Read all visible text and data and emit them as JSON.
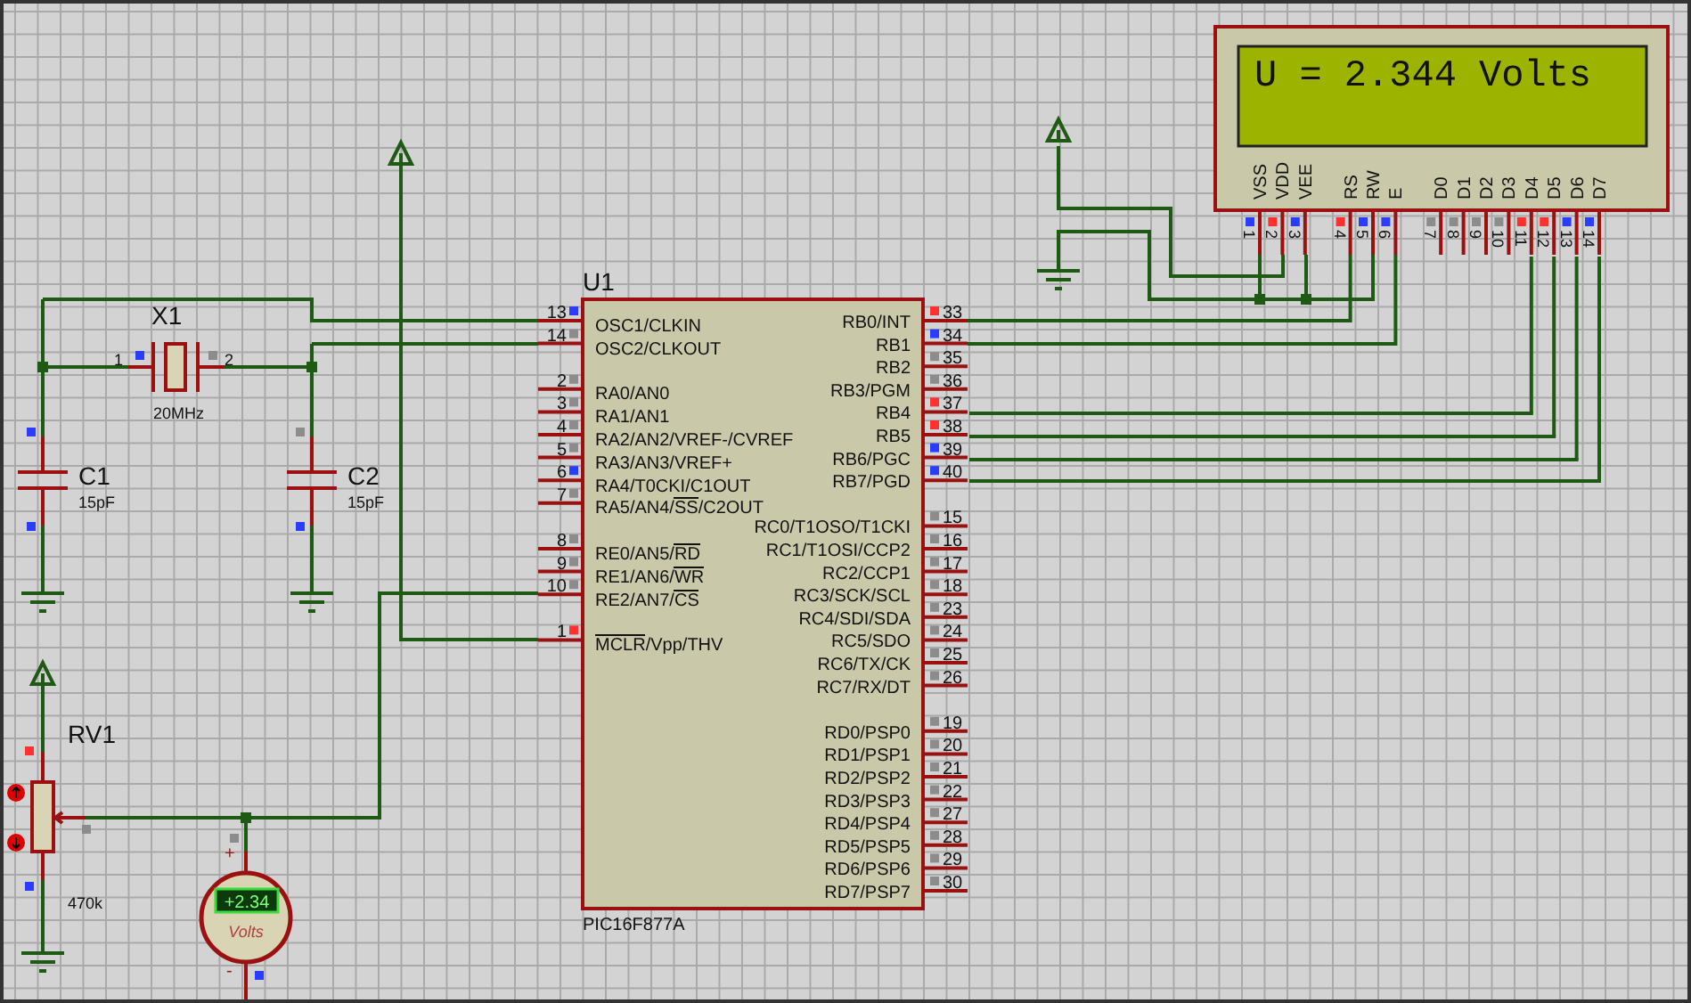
{
  "mcu": {
    "ref": "U1",
    "part": "PIC16F877A",
    "left_pins": [
      {
        "num": "13",
        "label": [
          {
            "text": "OSC1/CLKIN",
            "overline": false
          }
        ],
        "color": "#2a3cff"
      },
      {
        "num": "14",
        "label": [
          {
            "text": "OSC2/CLKOUT",
            "overline": false
          }
        ],
        "color": "#8c8c8c"
      },
      {
        "num": "2",
        "label": [
          {
            "text": "RA0/AN0",
            "overline": false
          }
        ],
        "color": "#8c8c8c"
      },
      {
        "num": "3",
        "label": [
          {
            "text": "RA1/AN1",
            "overline": false
          }
        ],
        "color": "#8c8c8c"
      },
      {
        "num": "4",
        "label": [
          {
            "text": "RA2/AN2/VREF-/CVREF",
            "overline": false
          }
        ],
        "color": "#8c8c8c"
      },
      {
        "num": "5",
        "label": [
          {
            "text": "RA3/AN3/VREF+",
            "overline": false
          }
        ],
        "color": "#8c8c8c"
      },
      {
        "num": "6",
        "label": [
          {
            "text": "RA4/T0CKI/C1OUT",
            "overline": false
          }
        ],
        "color": "#2a3cff"
      },
      {
        "num": "7",
        "label": [
          {
            "text": "RA5/AN4/",
            "overline": false
          },
          {
            "text": "SS",
            "overline": true
          },
          {
            "text": "/C2OUT",
            "overline": false
          }
        ],
        "color": "#8c8c8c"
      },
      {
        "num": "8",
        "label": [
          {
            "text": "RE0/AN5/",
            "overline": false
          },
          {
            "text": "RD",
            "overline": true
          }
        ],
        "color": "#8c8c8c"
      },
      {
        "num": "9",
        "label": [
          {
            "text": "RE1/AN6/",
            "overline": false
          },
          {
            "text": "WR",
            "overline": true
          }
        ],
        "color": "#8c8c8c"
      },
      {
        "num": "10",
        "label": [
          {
            "text": "RE2/AN7/",
            "overline": false
          },
          {
            "text": "CS",
            "overline": true
          }
        ],
        "color": "#8c8c8c"
      },
      {
        "num": "1",
        "label": [
          {
            "text": "MCLR",
            "overline": true
          },
          {
            "text": "/Vpp/THV",
            "overline": false
          }
        ],
        "color": "#ff3030"
      }
    ],
    "right_pins": [
      {
        "num": "33",
        "label": "RB0/INT",
        "color": "#ff3030"
      },
      {
        "num": "34",
        "label": "RB1",
        "color": "#2a3cff"
      },
      {
        "num": "35",
        "label": "RB2",
        "color": "#8c8c8c"
      },
      {
        "num": "36",
        "label": "RB3/PGM",
        "color": "#8c8c8c"
      },
      {
        "num": "37",
        "label": "RB4",
        "color": "#ff3030"
      },
      {
        "num": "38",
        "label": "RB5",
        "color": "#ff3030"
      },
      {
        "num": "39",
        "label": "RB6/PGC",
        "color": "#2a3cff"
      },
      {
        "num": "40",
        "label": "RB7/PGD",
        "color": "#2a3cff"
      },
      {
        "num": "15",
        "label": "RC0/T1OSO/T1CKI",
        "color": "#8c8c8c"
      },
      {
        "num": "16",
        "label": "RC1/T1OSI/CCP2",
        "color": "#8c8c8c"
      },
      {
        "num": "17",
        "label": "RC2/CCP1",
        "color": "#8c8c8c"
      },
      {
        "num": "18",
        "label": "RC3/SCK/SCL",
        "color": "#8c8c8c"
      },
      {
        "num": "23",
        "label": "RC4/SDI/SDA",
        "color": "#8c8c8c"
      },
      {
        "num": "24",
        "label": "RC5/SDO",
        "color": "#8c8c8c"
      },
      {
        "num": "25",
        "label": "RC6/TX/CK",
        "color": "#8c8c8c"
      },
      {
        "num": "26",
        "label": "RC7/RX/DT",
        "color": "#8c8c8c"
      },
      {
        "num": "19",
        "label": "RD0/PSP0",
        "color": "#8c8c8c"
      },
      {
        "num": "20",
        "label": "RD1/PSP1",
        "color": "#8c8c8c"
      },
      {
        "num": "21",
        "label": "RD2/PSP2",
        "color": "#8c8c8c"
      },
      {
        "num": "22",
        "label": "RD3/PSP3",
        "color": "#8c8c8c"
      },
      {
        "num": "27",
        "label": "RD4/PSP4",
        "color": "#8c8c8c"
      },
      {
        "num": "28",
        "label": "RD5/PSP5",
        "color": "#8c8c8c"
      },
      {
        "num": "29",
        "label": "RD6/PSP6",
        "color": "#8c8c8c"
      },
      {
        "num": "30",
        "label": "RD7/PSP7",
        "color": "#8c8c8c"
      }
    ]
  },
  "crystal": {
    "ref": "X1",
    "value": "20MHz",
    "pins": [
      {
        "num": "1",
        "color": "#2a3cff"
      },
      {
        "num": "2",
        "color": "#8c8c8c"
      }
    ]
  },
  "capacitors": [
    {
      "ref": "C1",
      "value": "15pF",
      "pins": [
        {
          "color": "#2a3cff"
        },
        {
          "color": "#2a3cff"
        }
      ]
    },
    {
      "ref": "C2",
      "value": "15pF",
      "pins": [
        {
          "color": "#8c8c8c"
        },
        {
          "color": "#2a3cff"
        }
      ]
    }
  ],
  "potentiometer": {
    "ref": "RV1",
    "value": "470k",
    "pins": [
      {
        "color": "#ff3030"
      },
      {
        "color": "#2a3cff"
      },
      {
        "color": "#8c8c8c"
      }
    ]
  },
  "voltmeter": {
    "reading": "+2.34",
    "unit": "Volts",
    "plus_sign": "+",
    "minus_sign": "-",
    "pins": [
      {
        "color": "#8c8c8c"
      },
      {
        "color": "#2a3cff"
      }
    ]
  },
  "lcd": {
    "text": "U = 2.344 Volts",
    "pins": [
      {
        "num": "1",
        "label": "VSS",
        "color": "#2a3cff"
      },
      {
        "num": "2",
        "label": "VDD",
        "color": "#ff3030"
      },
      {
        "num": "3",
        "label": "VEE",
        "color": "#2a3cff"
      },
      {
        "num": "4",
        "label": "RS",
        "color": "#ff3030"
      },
      {
        "num": "5",
        "label": "RW",
        "color": "#2a3cff"
      },
      {
        "num": "6",
        "label": "E",
        "color": "#2a3cff"
      },
      {
        "num": "7",
        "label": "D0",
        "color": "#8c8c8c"
      },
      {
        "num": "8",
        "label": "D1",
        "color": "#8c8c8c"
      },
      {
        "num": "9",
        "label": "D2",
        "color": "#8c8c8c"
      },
      {
        "num": "10",
        "label": "D3",
        "color": "#8c8c8c"
      },
      {
        "num": "11",
        "label": "D4",
        "color": "#ff3030"
      },
      {
        "num": "12",
        "label": "D5",
        "color": "#ff3030"
      },
      {
        "num": "13",
        "label": "D6",
        "color": "#2a3cff"
      },
      {
        "num": "14",
        "label": "D7",
        "color": "#2a3cff"
      }
    ]
  }
}
